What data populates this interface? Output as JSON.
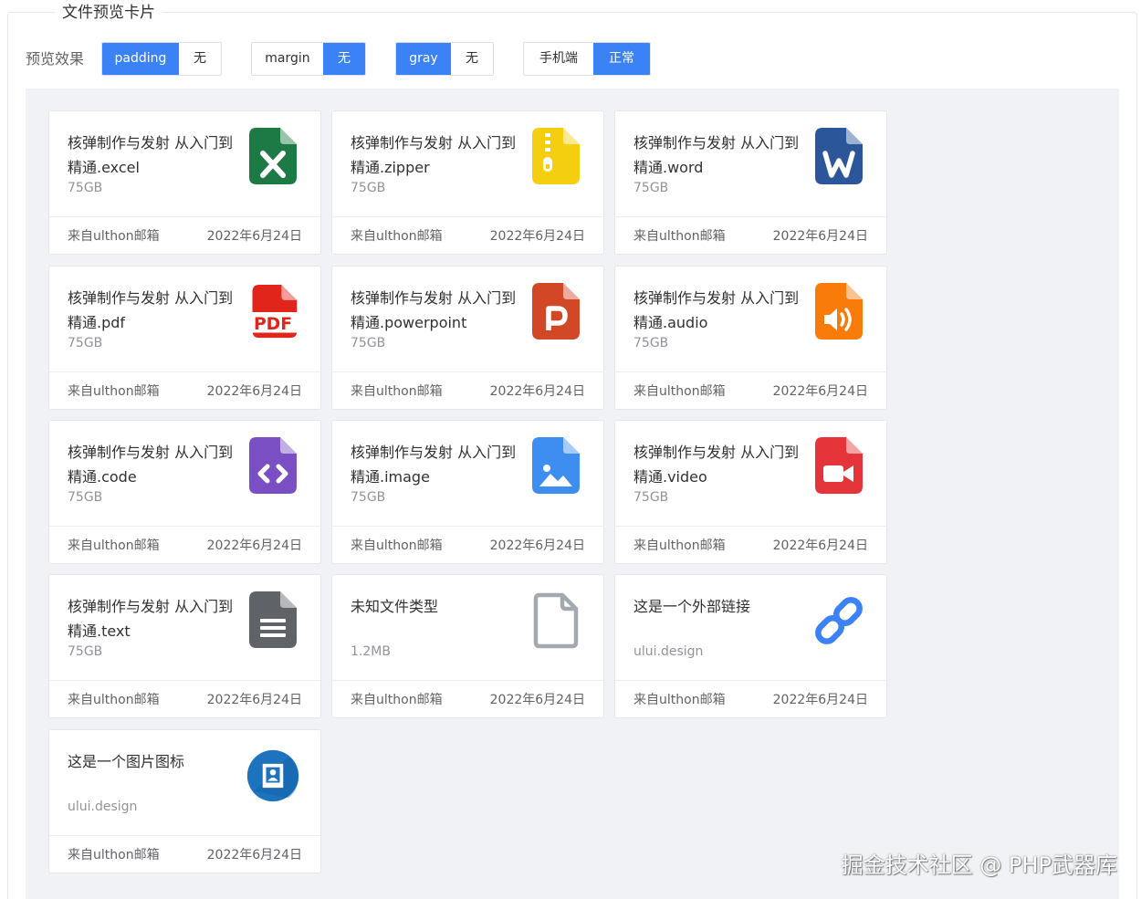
{
  "legend": "文件预览卡片",
  "controls": {
    "label": "预览效果",
    "groups": [
      {
        "options": [
          "padding",
          "无"
        ],
        "active": 0
      },
      {
        "options": [
          "margin",
          "无"
        ],
        "active": 1
      },
      {
        "options": [
          "gray",
          "无"
        ],
        "active": 0
      },
      {
        "options": [
          "手机端",
          "正常"
        ],
        "active": 1
      }
    ]
  },
  "cards": [
    {
      "name": "核弹制作与发射 从入门到精通.excel",
      "size": "75GB",
      "source": "来自ulthon邮箱",
      "date": "2022年6月24日",
      "icon": "excel-icon",
      "color": "#1d7a45"
    },
    {
      "name": "核弹制作与发射 从入门到精通.zipper",
      "size": "75GB",
      "source": "来自ulthon邮箱",
      "date": "2022年6月24日",
      "icon": "zipper-icon",
      "color": "#f4cf10"
    },
    {
      "name": "核弹制作与发射 从入门到精通.word",
      "size": "75GB",
      "source": "来自ulthon邮箱",
      "date": "2022年6月24日",
      "icon": "word-icon",
      "color": "#2b579a"
    },
    {
      "name": "核弹制作与发射 从入门到精通.pdf",
      "size": "75GB",
      "source": "来自ulthon邮箱",
      "date": "2022年6月24日",
      "icon": "pdf-icon",
      "color": "#e1251b"
    },
    {
      "name": "核弹制作与发射 从入门到精通.powerpoint",
      "size": "75GB",
      "source": "来自ulthon邮箱",
      "date": "2022年6月24日",
      "icon": "powerpoint-icon",
      "color": "#d24726"
    },
    {
      "name": "核弹制作与发射 从入门到精通.audio",
      "size": "75GB",
      "source": "来自ulthon邮箱",
      "date": "2022年6月24日",
      "icon": "audio-icon",
      "color": "#f97b0a"
    },
    {
      "name": "核弹制作与发射 从入门到精通.code",
      "size": "75GB",
      "source": "来自ulthon邮箱",
      "date": "2022年6月24日",
      "icon": "code-icon",
      "color": "#7b4fc4"
    },
    {
      "name": "核弹制作与发射 从入门到精通.image",
      "size": "75GB",
      "source": "来自ulthon邮箱",
      "date": "2022年6月24日",
      "icon": "image-icon",
      "color": "#3d8ef0"
    },
    {
      "name": "核弹制作与发射 从入门到精通.video",
      "size": "75GB",
      "source": "来自ulthon邮箱",
      "date": "2022年6月24日",
      "icon": "video-icon",
      "color": "#e5353a"
    },
    {
      "name": "核弹制作与发射 从入门到精通.text",
      "size": "75GB",
      "source": "来自ulthon邮箱",
      "date": "2022年6月24日",
      "icon": "text-icon",
      "color": "#5f6368"
    },
    {
      "name": "未知文件类型",
      "size": "1.2MB",
      "source": "来自ulthon邮箱",
      "date": "2022年6月24日",
      "icon": "unknown-file-icon",
      "color": "#a3a9b1"
    },
    {
      "name": "这是一个外部链接",
      "size": "ului.design",
      "source": "来自ulthon邮箱",
      "date": "2022年6月24日",
      "icon": "link-icon",
      "color": "#3b82f6"
    },
    {
      "name": "这是一个图片图标",
      "size": "ului.design",
      "source": "来自ulthon邮箱",
      "date": "2022年6月24日",
      "icon": "image-badge-icon",
      "color": "#1e73be"
    }
  ],
  "watermark": "掘金技术社区 @ PHP武器库"
}
